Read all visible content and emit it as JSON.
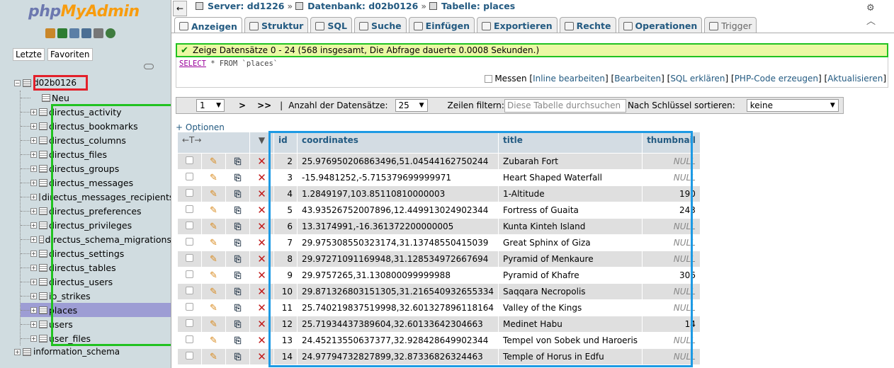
{
  "app": {
    "logo_php": "php",
    "logo_pma": "MyAdmin"
  },
  "nav": {
    "tab_recent": "Letzte",
    "tab_favorites": "Favoriten",
    "database": "d02b0126",
    "new_label": "Neu",
    "tables": [
      "directus_activity",
      "directus_bookmarks",
      "directus_columns",
      "directus_files",
      "directus_groups",
      "directus_messages",
      "directus_messages_recipients",
      "directus_preferences",
      "directus_privileges",
      "directus_schema_migrations",
      "directus_settings",
      "directus_tables",
      "directus_users",
      "ip_strikes",
      "places",
      "users",
      "user_files"
    ],
    "selected_table": "places",
    "other_db": "information_schema"
  },
  "breadcrumb": {
    "server": "Server: dd1226",
    "database": "Datenbank: d02b0126",
    "table": "Tabelle: places",
    "sep": "»"
  },
  "tabs": [
    "Anzeigen",
    "Struktur",
    "SQL",
    "Suche",
    "Einfügen",
    "Exportieren",
    "Rechte",
    "Operationen",
    "Trigger"
  ],
  "message": "Zeige Datensätze 0 - 24 (568 insgesamt, Die Abfrage dauerte 0.0008 Sekunden.)",
  "sql": {
    "select": "SELECT",
    "rest": " * FROM `places`"
  },
  "sql_links": {
    "profile": "Messen",
    "inline": "Inline bearbeiten",
    "edit": "Bearbeiten",
    "explain": "SQL erklären",
    "php": "PHP-Code erzeugen",
    "refresh": "Aktualisieren"
  },
  "navbar": {
    "page": "1",
    "next": ">",
    "last": ">>",
    "sep": "|",
    "rows_label": "Anzahl der Datensätze:",
    "rows_value": "25",
    "filter_label": "Zeilen filtern:",
    "filter_placeholder": "Diese Tabelle durchsuchen",
    "sort_label": "Nach Schlüssel sortieren:",
    "sort_value": "keine"
  },
  "options_link": "+ Optionen",
  "table": {
    "col_arrows": "←T→",
    "col_sort": "▼",
    "columns": [
      "id",
      "coordinates",
      "title",
      "thumbnail"
    ],
    "rows": [
      {
        "id": "2",
        "coordinates": "25.976950206863496,51.04544162750244",
        "title": "Zubarah Fort",
        "thumbnail": "NULL"
      },
      {
        "id": "3",
        "coordinates": "-15.9481252,-5.715379699999971",
        "title": "Heart Shaped Waterfall",
        "thumbnail": "NULL"
      },
      {
        "id": "4",
        "coordinates": "1.2849197,103.85110810000003",
        "title": "1-Altitude",
        "thumbnail": "190"
      },
      {
        "id": "5",
        "coordinates": "43.93526752007896,12.449913024902344",
        "title": "Fortress of Guaita",
        "thumbnail": "243"
      },
      {
        "id": "6",
        "coordinates": "13.3174991,-16.361372200000005",
        "title": "Kunta Kinteh Island",
        "thumbnail": "NULL"
      },
      {
        "id": "7",
        "coordinates": "29.975308550323174,31.13748550415039",
        "title": "Great Sphinx of Giza",
        "thumbnail": "NULL"
      },
      {
        "id": "8",
        "coordinates": "29.97271091169948,31.128534972667694",
        "title": "Pyramid of Menkaure",
        "thumbnail": "NULL"
      },
      {
        "id": "9",
        "coordinates": "29.9757265,31.130800099999988",
        "title": "Pyramid of Khafre",
        "thumbnail": "306"
      },
      {
        "id": "10",
        "coordinates": "29.871326803151305,31.216540932655334",
        "title": "Saqqara Necropolis",
        "thumbnail": "NULL"
      },
      {
        "id": "11",
        "coordinates": "25.740219837519998,32.601327896118164",
        "title": "Valley of the Kings",
        "thumbnail": "NULL"
      },
      {
        "id": "12",
        "coordinates": "25.71934437389604,32.60133642304663",
        "title": "Medinet Habu",
        "thumbnail": "14"
      },
      {
        "id": "13",
        "coordinates": "24.45213550637377,32.928428649902344",
        "title": "Tempel von Sobek und Haroeris",
        "thumbnail": "NULL"
      },
      {
        "id": "14",
        "coordinates": "24.97794732827899,32.87336826324463",
        "title": "Temple of Horus in Edfu",
        "thumbnail": "NULL"
      }
    ]
  },
  "colors": {
    "highlight_red": "#e3202a",
    "highlight_green": "#21c221",
    "highlight_blue": "#1d9ae4",
    "link": "#235a81"
  }
}
